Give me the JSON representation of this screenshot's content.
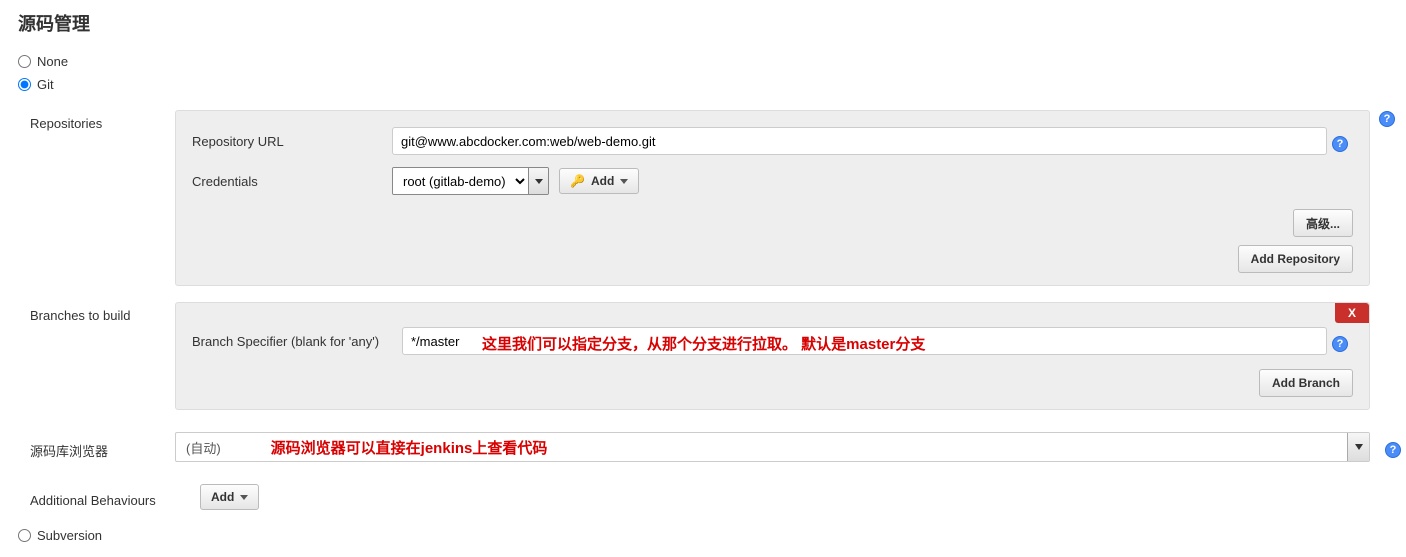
{
  "title": "源码管理",
  "scm_options": {
    "none": "None",
    "git": "Git",
    "subversion": "Subversion",
    "selected": "git"
  },
  "git": {
    "repositories_label": "Repositories",
    "repo_url_label": "Repository URL",
    "repo_url_value": "git@www.abcdocker.com:web/web-demo.git",
    "credentials_label": "Credentials",
    "credentials_value": "root (gitlab-demo)",
    "add_cred_label": "Add",
    "advanced_label": "高级...",
    "add_repo_label": "Add Repository",
    "branches_label": "Branches to build",
    "branch_specifier_label": "Branch Specifier (blank for 'any')",
    "branch_specifier_value": "*/master",
    "add_branch_label": "Add Branch",
    "delete_x": "X",
    "source_browser_label": "源码库浏览器",
    "source_browser_value": "(自动)",
    "additional_behaviours_label": "Additional Behaviours",
    "additional_behaviours_add": "Add"
  },
  "annotations": {
    "branch": "这里我们可以指定分支，从那个分支进行拉取。 默认是master分支",
    "browser": "源码浏览器可以直接在jenkins上查看代码"
  }
}
